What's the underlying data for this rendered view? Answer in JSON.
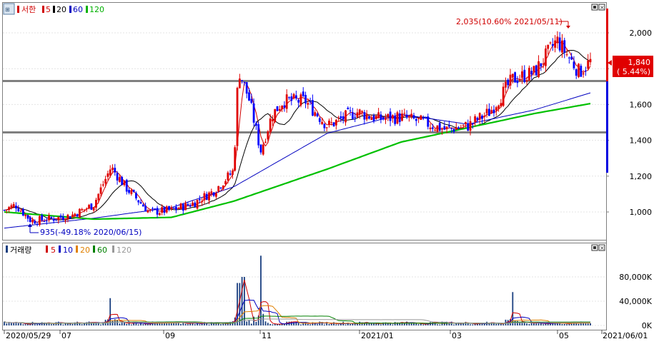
{
  "price_panel": {
    "name": "서한",
    "ma_legend": [
      {
        "label": "5",
        "color": "#d00000"
      },
      {
        "label": "20",
        "color": "#000000"
      },
      {
        "label": "60",
        "color": "#0000c0"
      },
      {
        "label": "120",
        "color": "#00b000"
      }
    ],
    "y_ticks": [
      "2,000",
      "1,800",
      "1,600",
      "1,400",
      "1,200",
      "1,000"
    ],
    "current_price": "1,840",
    "current_change": "( 5.44%)",
    "high_label": "2,035(10.60% 2021/05/11)",
    "low_label": "935(-49.18% 2020/06/15)"
  },
  "volume_panel": {
    "name": "거래량",
    "ma_legend": [
      {
        "label": "5",
        "color": "#d00000"
      },
      {
        "label": "10",
        "color": "#0000c0"
      },
      {
        "label": "20",
        "color": "#e08000"
      },
      {
        "label": "60",
        "color": "#008000"
      },
      {
        "label": "120",
        "color": "#999999"
      }
    ],
    "y_ticks": [
      "80,000K",
      "40,000K",
      "0K"
    ]
  },
  "x_axis": {
    "ticks": [
      "2020/05/29",
      "07",
      "09",
      "11",
      "2021/01",
      "03",
      "05",
      "2021/06/01"
    ]
  },
  "chart_data": {
    "type": "candlestick",
    "ylim": [
      800,
      2150
    ],
    "resistance_lines": [
      1735,
      1445
    ],
    "close": [
      {
        "date": "2020/05/29",
        "close": 1010
      },
      {
        "date": "2020/06/05",
        "close": 1040
      },
      {
        "date": "2020/06/15",
        "close": 950
      },
      {
        "date": "2020/06/26",
        "close": 960
      },
      {
        "date": "2020/07/10",
        "close": 980
      },
      {
        "date": "2020/07/24",
        "close": 1040
      },
      {
        "date": "2020/08/04",
        "close": 1250
      },
      {
        "date": "2020/08/14",
        "close": 1130
      },
      {
        "date": "2020/08/28",
        "close": 1000
      },
      {
        "date": "2020/09/11",
        "close": 1010
      },
      {
        "date": "2020/09/25",
        "close": 1050
      },
      {
        "date": "2020/10/08",
        "close": 1120
      },
      {
        "date": "2020/10/20",
        "close": 1230
      },
      {
        "date": "2020/10/23",
        "close": 1800
      },
      {
        "date": "2020/10/30",
        "close": 1620
      },
      {
        "date": "2020/11/06",
        "close": 1340
      },
      {
        "date": "2020/11/13",
        "close": 1540
      },
      {
        "date": "2020/11/20",
        "close": 1620
      },
      {
        "date": "2020/12/04",
        "close": 1620
      },
      {
        "date": "2020/12/18",
        "close": 1480
      },
      {
        "date": "2021/01/05",
        "close": 1560
      },
      {
        "date": "2021/01/19",
        "close": 1520
      },
      {
        "date": "2021/02/02",
        "close": 1530
      },
      {
        "date": "2021/02/16",
        "close": 1500
      },
      {
        "date": "2021/03/02",
        "close": 1460
      },
      {
        "date": "2021/03/16",
        "close": 1480
      },
      {
        "date": "2021/03/30",
        "close": 1560
      },
      {
        "date": "2021/04/13",
        "close": 1740
      },
      {
        "date": "2021/04/27",
        "close": 1780
      },
      {
        "date": "2021/05/11",
        "close": 1960
      },
      {
        "date": "2021/05/25",
        "close": 1780
      },
      {
        "date": "2021/06/01",
        "close": 1840
      }
    ],
    "ma120": [
      {
        "date": "2020/05/29",
        "value": 1000
      },
      {
        "date": "2020/07/24",
        "value": 960
      },
      {
        "date": "2020/09/11",
        "value": 970
      },
      {
        "date": "2020/10/20",
        "value": 1060
      },
      {
        "date": "2020/12/18",
        "value": 1240
      },
      {
        "date": "2021/02/02",
        "value": 1390
      },
      {
        "date": "2021/03/16",
        "value": 1470
      },
      {
        "date": "2021/04/27",
        "value": 1550
      },
      {
        "date": "2021/06/01",
        "value": 1605
      }
    ],
    "ma60": [
      {
        "date": "2020/05/29",
        "value": 910
      },
      {
        "date": "2020/07/24",
        "value": 965
      },
      {
        "date": "2020/09/11",
        "value": 1025
      },
      {
        "date": "2020/10/20",
        "value": 1140
      },
      {
        "date": "2020/12/18",
        "value": 1440
      },
      {
        "date": "2021/02/02",
        "value": 1545
      },
      {
        "date": "2021/03/16",
        "value": 1490
      },
      {
        "date": "2021/04/27",
        "value": 1570
      },
      {
        "date": "2021/06/01",
        "value": 1665
      }
    ],
    "volume_spikes": [
      {
        "date": "2020/08/04",
        "volume": 45000
      },
      {
        "date": "2020/10/23",
        "volume": 70000
      },
      {
        "date": "2020/10/26",
        "volume": 80000
      },
      {
        "date": "2020/11/06",
        "volume": 115000
      },
      {
        "date": "2021/04/13",
        "volume": 55000
      }
    ]
  }
}
